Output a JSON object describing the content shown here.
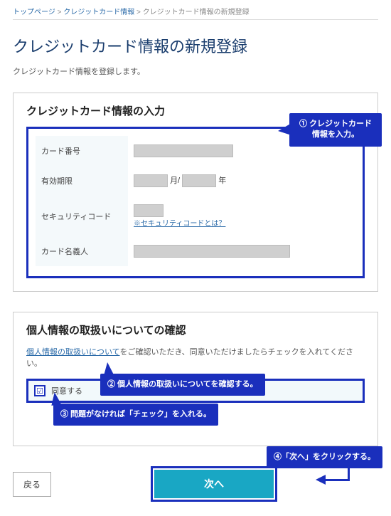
{
  "breadcrumb": {
    "home": "トップページ",
    "sep": ">",
    "mid": "クレジットカード情報",
    "current": "クレジットカード情報の新規登録"
  },
  "page": {
    "title": "クレジットカード情報の新規登録",
    "intro": "クレジットカード情報を登録します。"
  },
  "card_section": {
    "title": "クレジットカード情報の入力",
    "fields": {
      "number_label": "カード番号",
      "expiry_label": "有効期限",
      "expiry_month_suffix": "月/",
      "expiry_year_suffix": "年",
      "security_label": "セキュリティコード",
      "security_link": "※セキュリティコードとは？",
      "name_label": "カード名義人"
    }
  },
  "privacy_section": {
    "title": "個人情報の取扱いについての確認",
    "text_prefix_link": "個人情報の取扱いについて",
    "text_rest": "をご確認いただき、同意いただけましたらチェックを入れてください。",
    "agree_label": "同意する",
    "check_glyph": "☑"
  },
  "callouts": {
    "c1": "① クレジットカード情報を入力。",
    "c2": "② 個人情報の取扱いについてを確認する。",
    "c3": "③ 問題がなければ「チェック」を入れる。",
    "c4": "④「次へ」をクリックする。"
  },
  "buttons": {
    "back": "戻る",
    "next": "次へ"
  }
}
